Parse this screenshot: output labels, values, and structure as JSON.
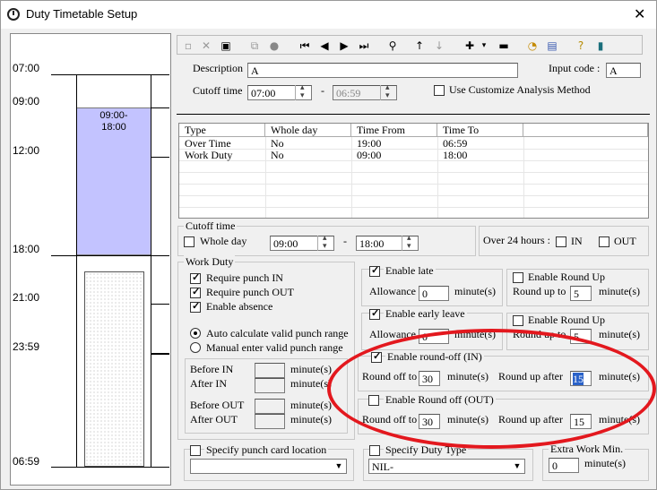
{
  "window": {
    "title": "Duty Timetable Setup",
    "close": "✕"
  },
  "timeline": {
    "times": [
      "07:00",
      "09:00",
      "12:00",
      "18:00",
      "21:00",
      "23:59",
      "06:59"
    ],
    "block": [
      "09:00-",
      "18:00"
    ]
  },
  "header": {
    "description_label": "Description",
    "description_value": "A",
    "input_code_label": "Input code :",
    "input_code_value": "A",
    "cutoff_label": "Cutoff time",
    "cutoff_from": "07:00",
    "cutoff_sep": "-",
    "cutoff_to": "06:59",
    "customize_label": "Use Customize Analysis Method",
    "customize_checked": false
  },
  "table": {
    "columns": [
      "Type",
      "Whole day",
      "Time From",
      "Time To"
    ],
    "rows": [
      [
        "Over Time",
        "No",
        "19:00",
        "06:59"
      ],
      [
        "Work Duty",
        "No",
        "09:00",
        "18:00"
      ]
    ]
  },
  "cutoff_group": {
    "title": "Cutoff time",
    "whole_day": "Whole day",
    "from": "09:00",
    "sep": "-",
    "to": "18:00"
  },
  "over24": {
    "label": "Over 24 hours :",
    "in": "IN",
    "out": "OUT"
  },
  "work_duty": {
    "title": "Work Duty",
    "require_in": "Require punch IN",
    "require_out": "Require punch OUT",
    "enable_absence": "Enable absence",
    "auto_calc": "Auto calculate valid punch range",
    "manual": "Manual enter valid punch range",
    "before_in": "Before IN",
    "after_in": "After IN",
    "before_out": "Before OUT",
    "after_out": "After OUT",
    "minutes": "minute(s)"
  },
  "late": {
    "enable": "Enable late",
    "allowance": "Allowance",
    "allowance_value": "0",
    "minutes": "minute(s)",
    "round_up": "Enable Round Up",
    "round_up_to": "Round up to",
    "round_up_value": "5"
  },
  "early": {
    "enable": "Enable early leave",
    "allowance": "Allowance",
    "allowance_value": "0",
    "minutes": "minute(s)",
    "round_up": "Enable Round Up",
    "round_up_to": "Round up to",
    "round_up_value": "5"
  },
  "round_in": {
    "enable": "Enable round-off (IN)",
    "round_off_to": "Round off to",
    "round_off_value": "30",
    "round_up_after": "Round up after",
    "round_up_after_value": "15",
    "minutes": "minute(s)"
  },
  "round_out": {
    "enable": "Enable Round off (OUT)",
    "round_off_to": "Round off to",
    "round_off_value": "30",
    "round_up_after": "Round up after",
    "round_up_after_value": "15",
    "minutes": "minute(s)"
  },
  "footer": {
    "punch_location": "Specify punch card location",
    "duty_type": "Specify Duty Type",
    "duty_type_value": "NIL-",
    "extra_work": "Extra Work Min.",
    "extra_work_value": "0",
    "minutes": "minute(s)"
  },
  "toolbar_icons": [
    "new-icon",
    "delete-icon",
    "save-icon",
    "copy-icon",
    "record-icon",
    "first-icon",
    "prev-icon",
    "next-icon",
    "last-icon",
    "find-icon",
    "up-icon",
    "down-icon",
    "add-icon",
    "dropdown-icon",
    "remove-icon",
    "clock-icon",
    "properties-icon",
    "help-icon",
    "exit-icon"
  ],
  "colors": {
    "block": "#c3c3ff",
    "annotation": "#e3181e",
    "selection": "#2a62c9"
  }
}
